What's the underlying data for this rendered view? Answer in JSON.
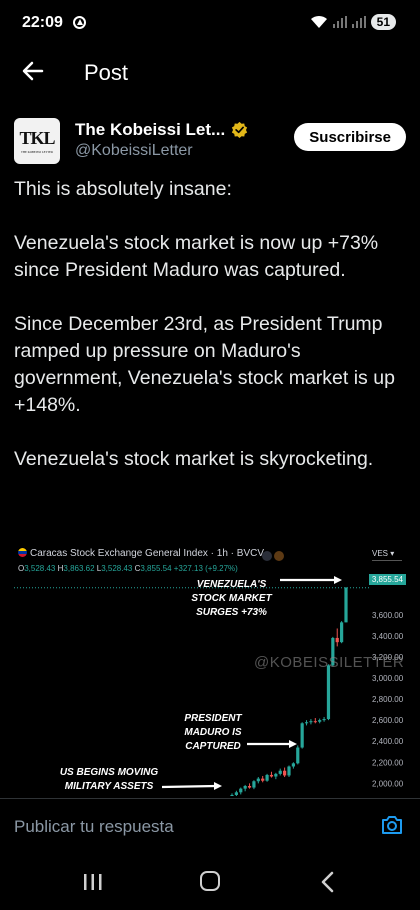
{
  "status_bar": {
    "time": "22:09",
    "battery": "51"
  },
  "header": {
    "title": "Post"
  },
  "author": {
    "avatar_text": "TKL",
    "avatar_subtext": "THE KOBEISSI LETTER",
    "name": "The Kobeissi Let...",
    "handle": "@KobeissiLetter",
    "subscribe_label": "Suscribirse"
  },
  "tweet": {
    "text": "This is absolutely insane:\n\nVenezuela's stock market is now up +73% since President Maduro was captured.\n\nSince December 23rd, as President Trump ramped up pressure on Maduro's government, Venezuela's stock market is up +148%.\n\nVenezuela's stock market is skyrocketing."
  },
  "chart_data": {
    "type": "candlestick",
    "title": "Caracas Stock Exchange General Index · 1h · BVCV",
    "ohlc": {
      "O": "3,528.43",
      "H": "3,863.62",
      "L": "3,528.43",
      "C": "3,855.54",
      "change": "+327.13 (+9.27%)"
    },
    "currency": "VES",
    "last_price": "3,855.54",
    "watermark": "@KOBEISSILETTER",
    "y_ticks": [
      "3,600.00",
      "3,400.00",
      "3,200.00",
      "3,000.00",
      "2,800.00",
      "2,600.00",
      "2,400.00",
      "2,200.00",
      "2,000.00"
    ],
    "y_range": [
      1880,
      3930
    ],
    "annotations": [
      "VENEZUELA'S\nSTOCK MARKET\nSURGES +73%",
      "PRESIDENT\nMADURO IS\nCAPTURED",
      "US BEGINS MOVING\nMILITARY ASSETS"
    ],
    "candles": [
      {
        "o": 1860,
        "h": 1905,
        "l": 1840,
        "c": 1890
      },
      {
        "o": 1890,
        "h": 1930,
        "l": 1870,
        "c": 1915
      },
      {
        "o": 1915,
        "h": 1960,
        "l": 1895,
        "c": 1950
      },
      {
        "o": 1950,
        "h": 1985,
        "l": 1925,
        "c": 1975
      },
      {
        "o": 1975,
        "h": 2000,
        "l": 1950,
        "c": 1960
      },
      {
        "o": 1960,
        "h": 2030,
        "l": 1945,
        "c": 2020
      },
      {
        "o": 2020,
        "h": 2060,
        "l": 2000,
        "c": 2045
      },
      {
        "o": 2045,
        "h": 2070,
        "l": 2010,
        "c": 2025
      },
      {
        "o": 2025,
        "h": 2090,
        "l": 2015,
        "c": 2080
      },
      {
        "o": 2080,
        "h": 2110,
        "l": 2055,
        "c": 2065
      },
      {
        "o": 2065,
        "h": 2100,
        "l": 2040,
        "c": 2090
      },
      {
        "o": 2090,
        "h": 2140,
        "l": 2075,
        "c": 2120
      },
      {
        "o": 2120,
        "h": 2150,
        "l": 2060,
        "c": 2075
      },
      {
        "o": 2075,
        "h": 2170,
        "l": 2060,
        "c": 2160
      },
      {
        "o": 2160,
        "h": 2200,
        "l": 2140,
        "c": 2190
      },
      {
        "o": 2190,
        "h": 2360,
        "l": 2180,
        "c": 2340
      },
      {
        "o": 2340,
        "h": 2580,
        "l": 2330,
        "c": 2570
      },
      {
        "o": 2570,
        "h": 2600,
        "l": 2550,
        "c": 2580
      },
      {
        "o": 2580,
        "h": 2610,
        "l": 2560,
        "c": 2590
      },
      {
        "o": 2590,
        "h": 2620,
        "l": 2570,
        "c": 2585
      },
      {
        "o": 2585,
        "h": 2615,
        "l": 2570,
        "c": 2600
      },
      {
        "o": 2600,
        "h": 2630,
        "l": 2585,
        "c": 2610
      },
      {
        "o": 2610,
        "h": 3130,
        "l": 2600,
        "c": 3120
      },
      {
        "o": 3120,
        "h": 3390,
        "l": 3110,
        "c": 3380
      },
      {
        "o": 3380,
        "h": 3470,
        "l": 3300,
        "c": 3340
      },
      {
        "o": 3340,
        "h": 3540,
        "l": 3330,
        "c": 3528
      },
      {
        "o": 3528,
        "h": 3864,
        "l": 3528,
        "c": 3856
      }
    ]
  },
  "reply": {
    "placeholder": "Publicar tu respuesta"
  }
}
